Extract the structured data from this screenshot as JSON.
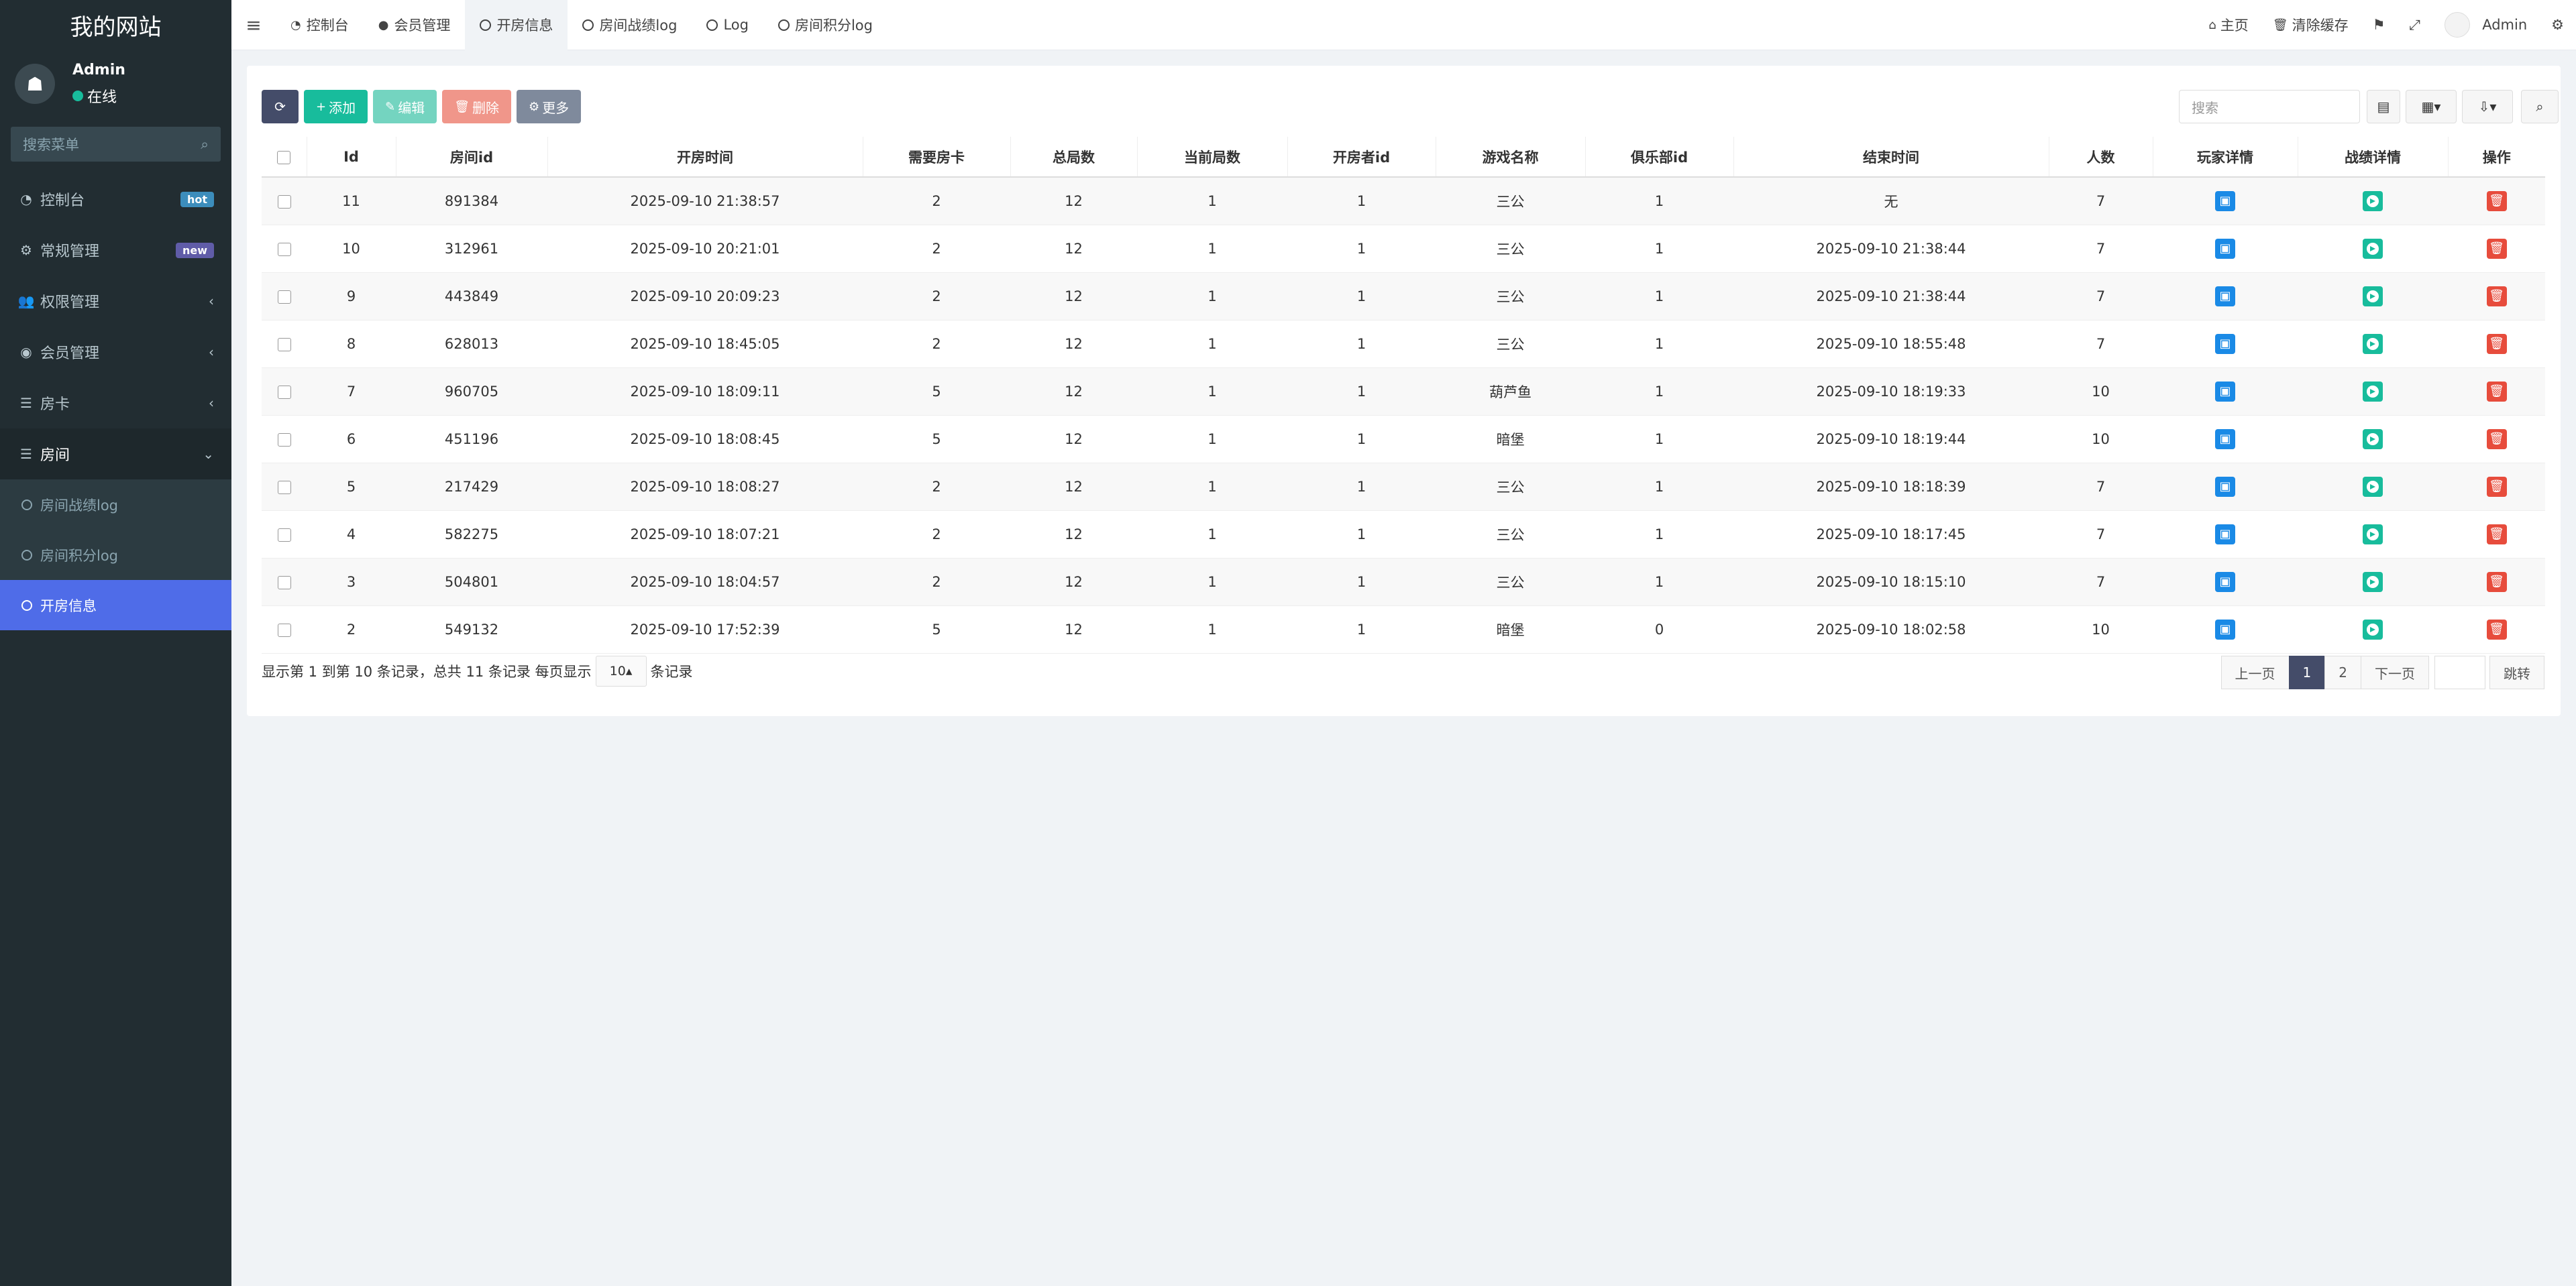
{
  "sidebar": {
    "site_title": "我的网站",
    "user": {
      "name": "Admin",
      "status": "在线"
    },
    "search_placeholder": "搜索菜单",
    "menu": [
      {
        "label": "控制台",
        "icon": "dashboard-icon",
        "badge": "hot"
      },
      {
        "label": "常规管理",
        "icon": "cogs-icon",
        "badge": "new"
      },
      {
        "label": "权限管理",
        "icon": "users-icon",
        "caret": "‹"
      },
      {
        "label": "会员管理",
        "icon": "user-circle-icon",
        "caret": "‹"
      },
      {
        "label": "房卡",
        "icon": "list-icon",
        "caret": "‹"
      },
      {
        "label": "房间",
        "icon": "list-icon",
        "caret": "⌄"
      }
    ],
    "submenu": [
      {
        "label": "房间战绩log"
      },
      {
        "label": "房间积分log"
      },
      {
        "label": "开房信息"
      }
    ]
  },
  "topbar": {
    "tabs": [
      {
        "label": "控制台"
      },
      {
        "label": "会员管理"
      },
      {
        "label": "开房信息"
      },
      {
        "label": "房间战绩log"
      },
      {
        "label": "Log"
      },
      {
        "label": "房间积分log"
      }
    ],
    "home_label": "主页",
    "clear_cache_label": "清除缓存",
    "admin_label": "Admin"
  },
  "toolbar": {
    "add_label": "添加",
    "edit_label": "编辑",
    "delete_label": "删除",
    "more_label": "更多",
    "search_placeholder": "搜索"
  },
  "table": {
    "columns": [
      "Id",
      "房间id",
      "开房时间",
      "需要房卡",
      "总局数",
      "当前局数",
      "开房者id",
      "游戏名称",
      "俱乐部id",
      "结束时间",
      "人数",
      "玩家详情",
      "战绩详情",
      "操作"
    ],
    "rows": [
      [
        "11",
        "891384",
        "2025-09-10 21:38:57",
        "2",
        "12",
        "1",
        "1",
        "三公",
        "1",
        "无",
        "7"
      ],
      [
        "10",
        "312961",
        "2025-09-10 20:21:01",
        "2",
        "12",
        "1",
        "1",
        "三公",
        "1",
        "2025-09-10 21:38:44",
        "7"
      ],
      [
        "9",
        "443849",
        "2025-09-10 20:09:23",
        "2",
        "12",
        "1",
        "1",
        "三公",
        "1",
        "2025-09-10 21:38:44",
        "7"
      ],
      [
        "8",
        "628013",
        "2025-09-10 18:45:05",
        "2",
        "12",
        "1",
        "1",
        "三公",
        "1",
        "2025-09-10 18:55:48",
        "7"
      ],
      [
        "7",
        "960705",
        "2025-09-10 18:09:11",
        "5",
        "12",
        "1",
        "1",
        "葫芦鱼",
        "1",
        "2025-09-10 18:19:33",
        "10"
      ],
      [
        "6",
        "451196",
        "2025-09-10 18:08:45",
        "5",
        "12",
        "1",
        "1",
        "暗堡",
        "1",
        "2025-09-10 18:19:44",
        "10"
      ],
      [
        "5",
        "217429",
        "2025-09-10 18:08:27",
        "2",
        "12",
        "1",
        "1",
        "三公",
        "1",
        "2025-09-10 18:18:39",
        "7"
      ],
      [
        "4",
        "582275",
        "2025-09-10 18:07:21",
        "2",
        "12",
        "1",
        "1",
        "三公",
        "1",
        "2025-09-10 18:17:45",
        "7"
      ],
      [
        "3",
        "504801",
        "2025-09-10 18:04:57",
        "2",
        "12",
        "1",
        "1",
        "三公",
        "1",
        "2025-09-10 18:15:10",
        "7"
      ],
      [
        "2",
        "549132",
        "2025-09-10 17:52:39",
        "5",
        "12",
        "1",
        "1",
        "暗堡",
        "0",
        "2025-09-10 18:02:58",
        "10"
      ]
    ]
  },
  "footer": {
    "summary": "显示第 1 到第 10 条记录，总共 11 条记录 每页显示",
    "page_size": "10",
    "unit": "条记录",
    "prev": "上一页",
    "pages": [
      "1",
      "2"
    ],
    "next": "下一页",
    "jump": "跳转"
  }
}
